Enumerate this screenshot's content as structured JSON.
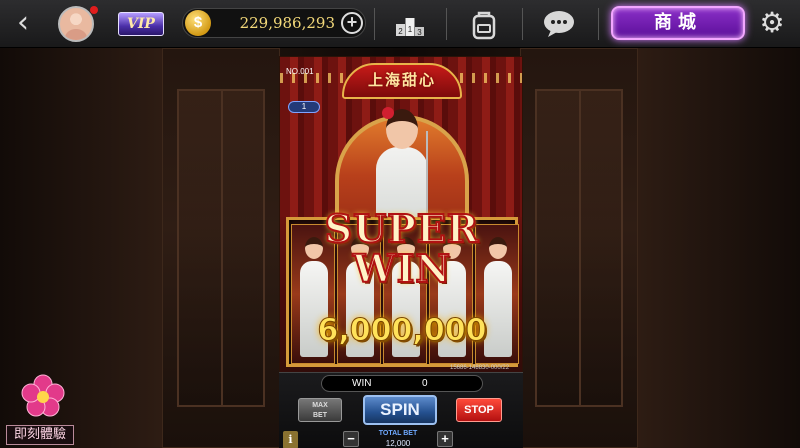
{
  "topbar": {
    "vip_label": "VIP",
    "coin_symbol": "$",
    "coins": "229,986,293",
    "add_symbol": "+",
    "shop_label": "商城"
  },
  "icons": {
    "back": "chevron-left-icon",
    "avatar": "user-avatar-icon",
    "rank": "podium-icon",
    "bag": "backpack-icon",
    "chat": "chat-bubble-icon",
    "settings": "gear-icon"
  },
  "game": {
    "machine_no": "NO.001",
    "title": "上海甜心",
    "line_badge": "1",
    "super_line1": "SUPER",
    "super_line2": "WIN",
    "win_amount": "6,000,000",
    "machine_code": "15686-148830-000/22"
  },
  "panel": {
    "win_label": "WIN",
    "win_value": "0",
    "maxbet_line1": "MAX",
    "maxbet_line2": "BET",
    "spin_label": "SPIN",
    "stop_label": "STOP",
    "info_label": "i",
    "minus_label": "−",
    "plus_label": "+",
    "total_bet_label": "TOTAL BET",
    "total_bet_value": "12,000"
  },
  "trial": {
    "label": "即刻體驗"
  },
  "colors": {
    "shop_purple": "#8a2fc7",
    "win_gold": "#ffe25a",
    "spin_blue": "#24508f",
    "stop_red": "#d61f15"
  }
}
